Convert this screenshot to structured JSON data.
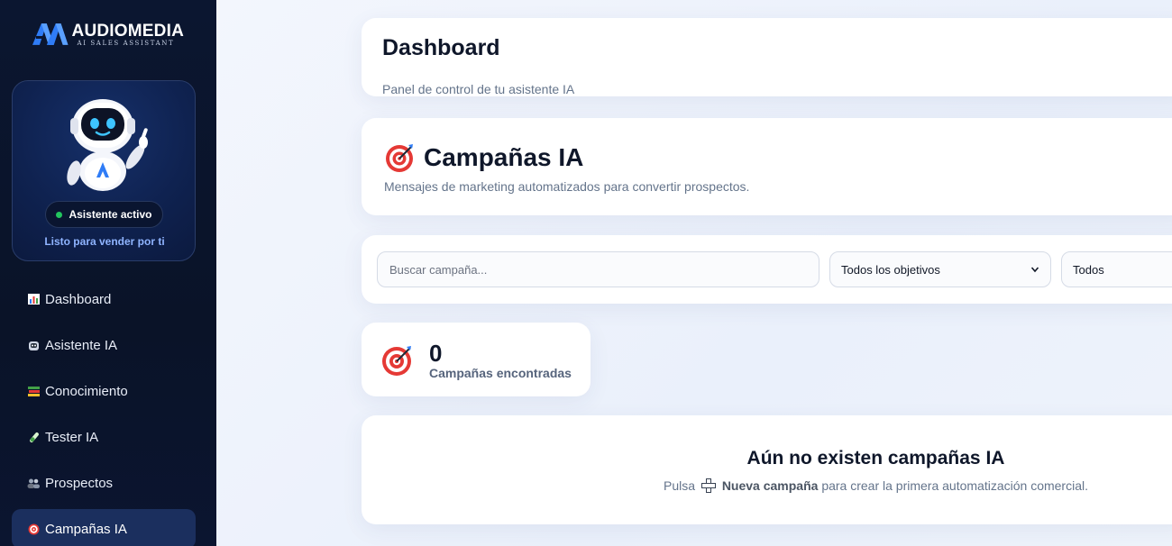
{
  "brand": {
    "name": "AUDIOMEDIA",
    "tagline": "AI SALES ASSISTANT",
    "logo_icon": "audiomedia-logo-icon",
    "accent": "#2f7cf6"
  },
  "assistant_card": {
    "status": "Asistente activo",
    "subtitle": "Listo para vender por ti",
    "status_color": "#22c55e",
    "robot_icon": "robot-mascot-icon"
  },
  "nav": {
    "items": [
      {
        "label": "Dashboard",
        "icon": "bar-chart-icon",
        "active": false
      },
      {
        "label": "Asistente IA",
        "icon": "robot-face-icon",
        "active": false
      },
      {
        "label": "Conocimiento",
        "icon": "books-icon",
        "active": false
      },
      {
        "label": "Tester IA",
        "icon": "test-tube-icon",
        "active": false
      },
      {
        "label": "Prospectos",
        "icon": "people-icon",
        "active": false
      },
      {
        "label": "Campañas IA",
        "icon": "target-icon",
        "active": true
      }
    ]
  },
  "header": {
    "title": "Dashboard",
    "subtitle": "Panel de control de tu asistente IA"
  },
  "section": {
    "title": "Campañas IA",
    "subtitle": "Mensajes de marketing automatizados para convertir prospectos.",
    "icon": "target-icon"
  },
  "filters": {
    "search_placeholder": "Buscar campaña...",
    "search_value": "",
    "objective_selected": "Todos los objetivos",
    "status_selected": "Todos"
  },
  "stats": {
    "count": "0",
    "label": "Campañas encontradas",
    "icon": "target-icon"
  },
  "empty_state": {
    "title": "Aún no existen campañas IA",
    "text_before": "Pulsa",
    "button_ref": "Nueva campaña",
    "text_after": "para crear la primera automatización comercial.",
    "icon": "plus-icon"
  }
}
